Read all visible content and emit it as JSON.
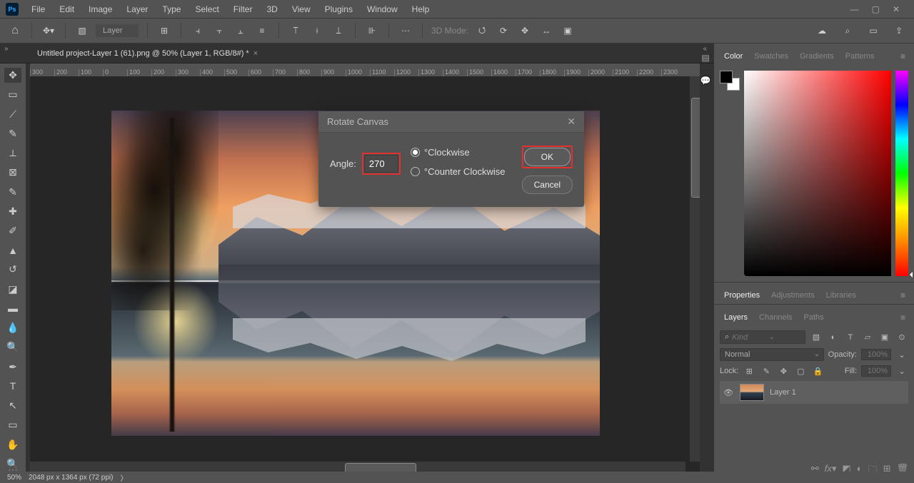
{
  "menubar": {
    "items": [
      "File",
      "Edit",
      "Image",
      "Layer",
      "Type",
      "Select",
      "Filter",
      "3D",
      "View",
      "Plugins",
      "Window",
      "Help"
    ]
  },
  "optbar": {
    "layer_drop": "Layer",
    "mode_label": "3D Mode:",
    "home_icon": "⌂"
  },
  "tab": {
    "title": "Untitled project-Layer 1 (61).png @ 50% (Layer 1, RGB/8#) *"
  },
  "ruler": {
    "marks": [
      "300",
      "200",
      "100",
      "0",
      "100",
      "200",
      "300",
      "400",
      "500",
      "600",
      "700",
      "800",
      "900",
      "1000",
      "1100",
      "1200",
      "1300",
      "1400",
      "1500",
      "1600",
      "1700",
      "1800",
      "1900",
      "2000",
      "2100",
      "2200",
      "2300"
    ]
  },
  "status": {
    "zoom": "50%",
    "dims": "2048 px x 1364 px (72 ppi)"
  },
  "panels": {
    "color_tabs": [
      "Color",
      "Swatches",
      "Gradients",
      "Patterns"
    ],
    "props_tabs": [
      "Properties",
      "Adjustments",
      "Libraries"
    ],
    "layer_tabs": [
      "Layers",
      "Channels",
      "Paths"
    ],
    "kind_placeholder": "Kind",
    "blend_mode": "Normal",
    "opacity_label": "Opacity:",
    "opacity_value": "100%",
    "lock_label": "Lock:",
    "fill_label": "Fill:",
    "fill_value": "100%",
    "layer_name": "Layer 1"
  },
  "dialog": {
    "title": "Rotate Canvas",
    "angle_label": "Angle:",
    "angle_value": "270",
    "cw_label": "°Clockwise",
    "ccw_label": "°Counter Clockwise",
    "ok": "OK",
    "cancel": "Cancel"
  }
}
